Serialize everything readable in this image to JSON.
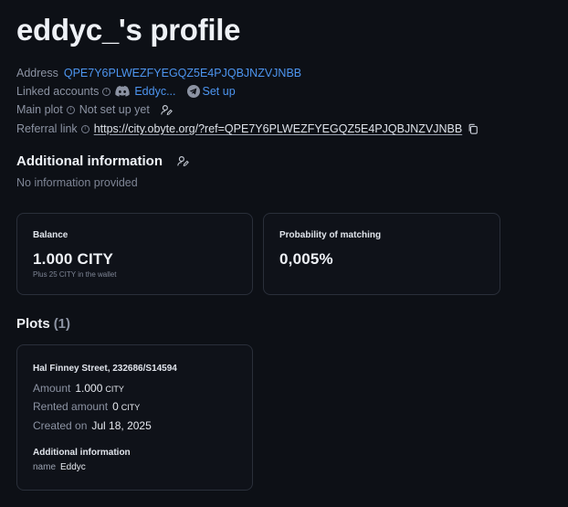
{
  "profile": {
    "title": "eddyc_'s profile",
    "address_label": "Address",
    "address": "QPE7Y6PLWEZFYEGQZ5E4PJQBJNZVJNBB",
    "linked_label": "Linked accounts",
    "discord_name": "Eddyc...",
    "telegram_action": "Set up",
    "main_plot_label": "Main plot",
    "main_plot_value": "Not set up yet",
    "referral_label": "Referral link",
    "referral_url": "https://city.obyte.org/?ref=QPE7Y6PLWEZFYEGQZ5E4PJQBJNZVJNBB"
  },
  "additional": {
    "title": "Additional information",
    "empty_text": "No information provided"
  },
  "stats": {
    "balance_label": "Balance",
    "balance_value": "1.000 CITY",
    "balance_sub": "Plus 25 CITY in the wallet",
    "prob_label": "Probability of matching",
    "prob_value": "0,005%"
  },
  "plots": {
    "title": "Plots",
    "count": "(1)",
    "items": [
      {
        "name": "Hal Finney Street, 232686/S14594",
        "amount_label": "Amount",
        "amount_value": "1.000",
        "amount_unit": "CITY",
        "rented_label": "Rented amount",
        "rented_value": "0",
        "rented_unit": "CITY",
        "created_label": "Created on",
        "created_value": "Jul 18, 2025",
        "additional_title": "Additional information",
        "name_key": "name",
        "name_value": "Eddyc"
      }
    ]
  },
  "colors": {
    "background": "#0d1016",
    "accent_link": "#4d95f0",
    "card_border": "#2a2f3a"
  },
  "icons": [
    "info-icon",
    "discord-icon",
    "telegram-icon",
    "user-edit-icon",
    "copy-icon"
  ]
}
